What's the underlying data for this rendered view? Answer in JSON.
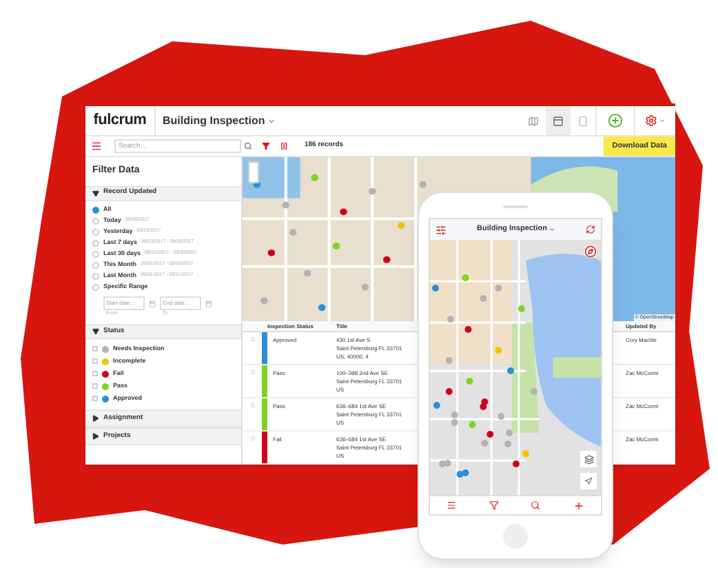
{
  "app": {
    "logo": "fulcrum",
    "title": "Building Inspection"
  },
  "toolbar": {
    "search_placeholder": "Search...",
    "record_count": "186 records",
    "download": "Download Data"
  },
  "filter": {
    "title": "Filter Data",
    "record_updated": {
      "label": "Record Updated",
      "expanded": true,
      "options": [
        {
          "label": "All",
          "selected": true
        },
        {
          "label": "Today",
          "hint": "09/30/2017",
          "selected": false
        },
        {
          "label": "Yesterday",
          "hint": "09/29/2017",
          "selected": false
        },
        {
          "label": "Last 7 days",
          "hint": "09/23/2017 - 09/30/2017",
          "selected": false
        },
        {
          "label": "Last 30 days",
          "hint": "08/31/2017 - 09/30/2017",
          "selected": false
        },
        {
          "label": "This Month",
          "hint": "09/01/2017 - 09/30/2017",
          "selected": false
        },
        {
          "label": "Last Month",
          "hint": "08/01/2017 - 08/31/2017",
          "selected": false
        },
        {
          "label": "Specific Range",
          "selected": false
        }
      ],
      "start_placeholder": "Start date...",
      "end_placeholder": "End date...",
      "from": "From",
      "to": "To"
    },
    "status": {
      "label": "Status",
      "expanded": true,
      "options": [
        {
          "label": "Needs Inspection",
          "color": "#b3b3b3",
          "checked": false
        },
        {
          "label": "Incomplete",
          "color": "#f5c400",
          "checked": false
        },
        {
          "label": "Fail",
          "color": "#d0021b",
          "checked": false
        },
        {
          "label": "Pass",
          "color": "#7ed321",
          "checked": false
        },
        {
          "label": "Approved",
          "color": "#2a8fd6",
          "checked": false
        }
      ]
    },
    "sections": [
      {
        "label": "Assignment",
        "expanded": false
      },
      {
        "label": "Projects",
        "expanded": false
      }
    ]
  },
  "map": {
    "attribution": "© OpenStreetMap"
  },
  "table": {
    "columns": [
      "Inspection Status",
      "Title",
      "Updated By"
    ],
    "rows": [
      {
        "status": "Approved",
        "color": "#2a8fd6",
        "title": [
          "430 1st Ave S",
          "Saint Petersburg FL 33701",
          "US, 40000, 4"
        ],
        "updated_by": "Cory Machle"
      },
      {
        "status": "Pass",
        "color": "#7ed321",
        "title": [
          "100–398 2nd Ave SE",
          "Saint Petersburg FL 33701",
          "US"
        ],
        "updated_by": "Zac McCormi"
      },
      {
        "status": "Pass",
        "color": "#7ed321",
        "title": [
          "636–684 1st Ave SE",
          "Saint Petersburg FL 33701",
          "US"
        ],
        "updated_by": "Zac McCormi"
      },
      {
        "status": "Fail",
        "color": "#d0021b",
        "title": [
          "636–684 1st Ave SE",
          "Saint Petersburg FL 33701",
          "US"
        ],
        "updated_by": "Zac McCormi"
      }
    ]
  },
  "phone": {
    "title": "Building Inspection"
  }
}
